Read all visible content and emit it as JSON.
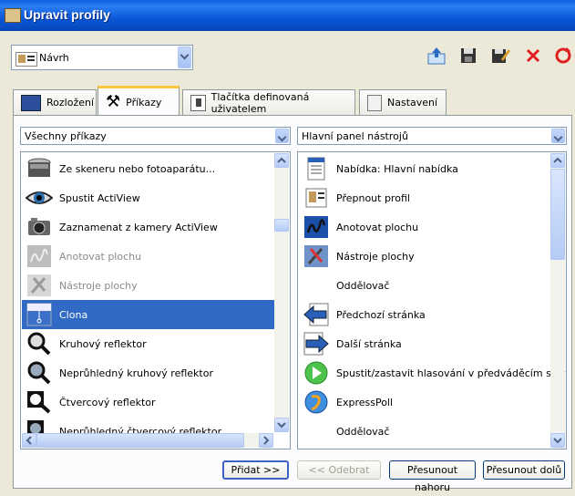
{
  "window": {
    "title": "Upravit profily"
  },
  "profile_select": {
    "value": "Návrh"
  },
  "tabs": [
    {
      "label": "Rozložení"
    },
    {
      "label": "Příkazy"
    },
    {
      "label": "Tlačítka definovaná uživatelem"
    },
    {
      "label": "Nastavení"
    }
  ],
  "left_filter": {
    "value": "Všechny příkazy"
  },
  "right_filter": {
    "value": "Hlavní panel nástrojů"
  },
  "left_list": [
    {
      "label": "Ze skeneru nebo fotoaparátu...",
      "icon": "scanner-icon",
      "state": "normal"
    },
    {
      "label": "Spustit ActiView",
      "icon": "eye-icon",
      "state": "normal"
    },
    {
      "label": "Zaznamenat z kamery ActiView",
      "icon": "camera-icon",
      "state": "normal"
    },
    {
      "label": "Anotovat plochu",
      "icon": "annotate-icon",
      "state": "disabled"
    },
    {
      "label": "Nástroje plochy",
      "icon": "desktop-tools-icon",
      "state": "disabled"
    },
    {
      "label": "Clona",
      "icon": "blind-icon",
      "state": "selected"
    },
    {
      "label": "Kruhový reflektor",
      "icon": "spotlight-icon",
      "state": "normal"
    },
    {
      "label": "Neprůhledný kruhový reflektor",
      "icon": "spotlight-opaque-icon",
      "state": "normal"
    },
    {
      "label": "Čtvercový reflektor",
      "icon": "square-spotlight-icon",
      "state": "normal"
    },
    {
      "label": "Neprůhledný čtvercový reflektor",
      "icon": "square-spotlight-opaque-icon",
      "state": "normal"
    }
  ],
  "right_list": [
    {
      "label": "Nabídka: Hlavní nabídka",
      "icon": "menu-icon"
    },
    {
      "label": "Přepnout profil",
      "icon": "profile-icon"
    },
    {
      "label": "Anotovat plochu",
      "icon": "annotate-icon"
    },
    {
      "label": "Nástroje plochy",
      "icon": "desktop-tools-icon"
    },
    {
      "label": "Oddělovač",
      "icon": ""
    },
    {
      "label": "Předchozí stránka",
      "icon": "arrow-left-icon"
    },
    {
      "label": "Další stránka",
      "icon": "arrow-right-icon"
    },
    {
      "label": "Spustit/zastavit hlasování v předváděcím sešitu",
      "icon": "play-icon"
    },
    {
      "label": "ExpressPoll",
      "icon": "expresspoll-icon"
    },
    {
      "label": "Oddělovač",
      "icon": ""
    }
  ],
  "buttons": {
    "add": "Přidat >>",
    "remove": "<< Odebrat",
    "move_up": "Přesunout nahoru",
    "move_down": "Přesunout dolů"
  },
  "colors": {
    "titlebar": "#0a57d8",
    "selection": "#316ac5",
    "tab_highlight": "#ffc83c"
  }
}
